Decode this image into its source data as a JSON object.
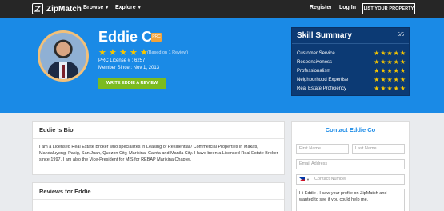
{
  "nav": {
    "logo": "ZipMatch",
    "browse": "Browse",
    "explore": "Explore",
    "register": "Register",
    "login": "Log In",
    "list_property": "LIST YOUR PROPERTY"
  },
  "profile": {
    "name": "Eddie Co",
    "badge": "PRC",
    "rating": 5,
    "based_on": "(Based on 1 Review)",
    "prc_license": "PRC License # : 6257",
    "member_since": "Member Since : Nov 1, 2013",
    "write_review": "WRITE EDDIE A REVIEW"
  },
  "skills": {
    "title": "Skill Summary",
    "score": "5/5",
    "items": [
      {
        "label": "Customer Service",
        "stars": 5
      },
      {
        "label": "Responsiveness",
        "stars": 5
      },
      {
        "label": "Professionalism",
        "stars": 5
      },
      {
        "label": "Neighborhood Expertise",
        "stars": 5
      },
      {
        "label": "Real Estate Proficiency",
        "stars": 5
      }
    ]
  },
  "bio": {
    "title": "Eddie 's Bio",
    "text": "I am a Licensed Real Estate Broker who specializes in Leasing of Residential / Commercial Properties in Makati, Mandaluyong, Pasig, San Juan, Quezon City, Marikina, Cainta and Manila City. I have been a Licensed Real Estate Broker since 1997. I am also the Vice-President for MIS for REBAP Marikina Chapter."
  },
  "reviews": {
    "title": "Reviews for Eddie"
  },
  "contact": {
    "title": "Contact Eddie Co",
    "first_name_placeholder": "First Name",
    "last_name_placeholder": "Last Name",
    "email_placeholder": "Email Address",
    "phone_placeholder": "Contact Number",
    "message": "Hi Eddie , I saw your profile on ZipMatch and wanted to see if you could help me."
  },
  "colors": {
    "hero": "#1a8ae6",
    "skill_panel": "#0c3a74",
    "star": "#f7c600",
    "cta": "#7cbb1f",
    "nav": "#262626"
  }
}
